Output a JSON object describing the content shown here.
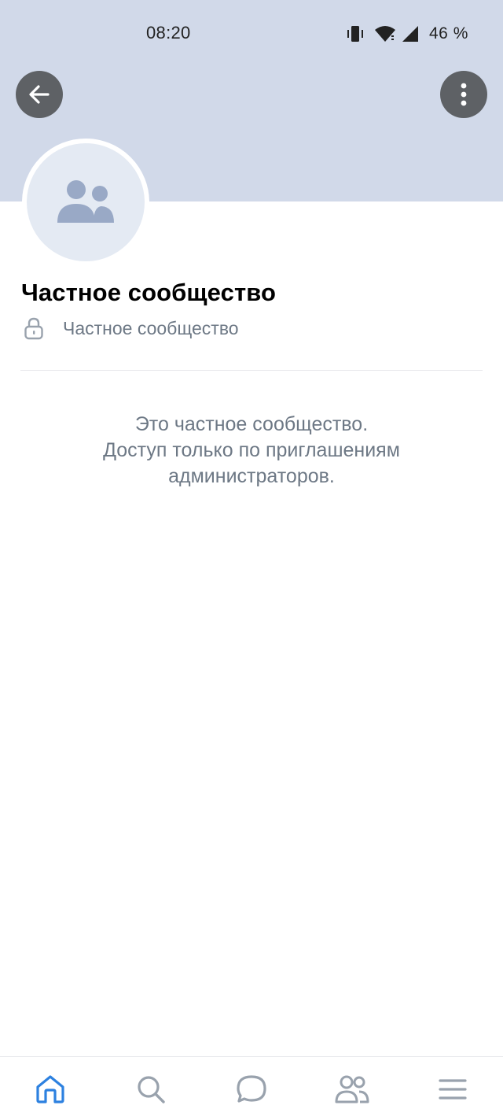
{
  "status_bar": {
    "time": "08:20",
    "battery": "46 %",
    "icons": [
      "vibrate-icon",
      "wifi-icon",
      "signal-icon"
    ]
  },
  "header": {
    "back_icon": "arrow-left-icon",
    "more_icon": "more-vertical-icon"
  },
  "community": {
    "avatar_icon": "users-icon",
    "title": "Частное сообщество",
    "type_icon": "lock-icon",
    "type_label": "Частное сообщество",
    "message_lines": [
      "Это частное сообщество.",
      "Доступ только по приглашениям",
      "администраторов."
    ]
  },
  "tab_bar": {
    "tabs": [
      {
        "icon": "home-icon",
        "active": true
      },
      {
        "icon": "search-icon",
        "active": false
      },
      {
        "icon": "messages-icon",
        "active": false
      },
      {
        "icon": "friends-icon",
        "active": false
      },
      {
        "icon": "menu-icon",
        "active": false
      }
    ]
  },
  "colors": {
    "cover": "#d1d9e9",
    "accent": "#2d81e0",
    "icon_gray": "#99a2ad",
    "secondary_text": "#6d7885",
    "button_bg": "#5e6165"
  }
}
